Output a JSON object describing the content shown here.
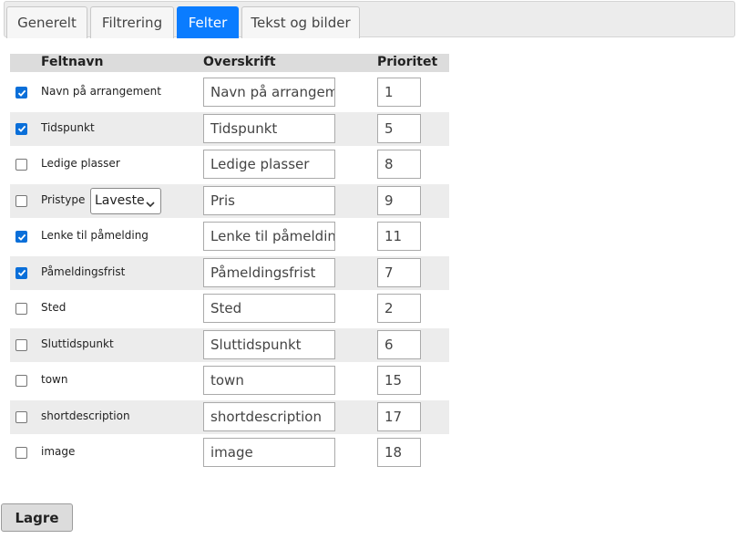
{
  "tabs": [
    {
      "label": "Generelt",
      "active": false
    },
    {
      "label": "Filtrering",
      "active": false
    },
    {
      "label": "Felter",
      "active": true
    },
    {
      "label": "Tekst og bilder",
      "active": false
    }
  ],
  "columns": {
    "field": "Feltnavn",
    "heading": "Overskrift",
    "priority": "Prioritet"
  },
  "rows": [
    {
      "field": "Navn på arrangement",
      "heading": "Navn på arrangement",
      "priority": "1",
      "checked": true
    },
    {
      "field": "Tidspunkt",
      "heading": "Tidspunkt",
      "priority": "5",
      "checked": true
    },
    {
      "field": "Ledige plasser",
      "heading": "Ledige plasser",
      "priority": "8",
      "checked": false
    },
    {
      "field": "Pristype",
      "heading": "Pris",
      "priority": "9",
      "checked": false,
      "select_value": "Laveste"
    },
    {
      "field": "Lenke til påmelding",
      "heading": "Lenke til påmelding",
      "priority": "11",
      "checked": true
    },
    {
      "field": "Påmeldingsfrist",
      "heading": "Påmeldingsfrist",
      "priority": "7",
      "checked": true
    },
    {
      "field": "Sted",
      "heading": "Sted",
      "priority": "2",
      "checked": false
    },
    {
      "field": "Sluttidspunkt",
      "heading": "Sluttidspunkt",
      "priority": "6",
      "checked": false
    },
    {
      "field": "town",
      "heading": "town",
      "priority": "15",
      "checked": false
    },
    {
      "field": "shortdescription",
      "heading": "shortdescription",
      "priority": "17",
      "checked": false
    },
    {
      "field": "image",
      "heading": "image",
      "priority": "18",
      "checked": false
    }
  ],
  "save_label": "Lagre",
  "colors": {
    "accent": "#0a7cff",
    "checkbox": "#0a6fd9",
    "row_alt": "#ececec"
  }
}
